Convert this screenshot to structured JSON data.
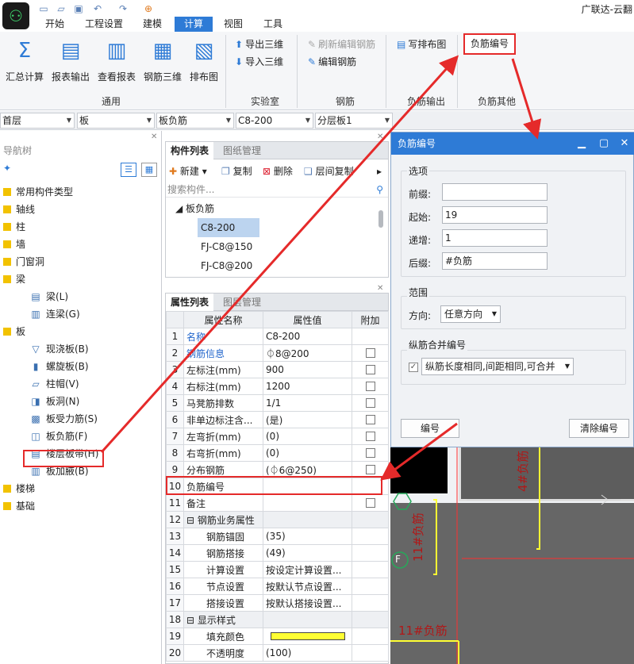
{
  "window": {
    "title": "广联达-云翻"
  },
  "menus": [
    "开始",
    "工程设置",
    "建模",
    "计算",
    "视图",
    "工具"
  ],
  "ribbon": {
    "big_buttons": [
      "汇总计算",
      "报表输出",
      "查看报表",
      "钢筋三维",
      "排布图"
    ],
    "lab_buttons": [
      "导出三维",
      "导入三维"
    ],
    "rebar_buttons": [
      "刷新编辑钢筋",
      "编辑钢筋"
    ],
    "output_button": "写排布图",
    "other_button": "负筋编号",
    "groups": [
      "通用",
      "实验室",
      "钢筋",
      "负筋输出",
      "负筋其他"
    ]
  },
  "selectors": [
    "首层",
    "板",
    "板负筋",
    "C8-200",
    "分层板1"
  ],
  "nav": {
    "title": "导航树",
    "items": [
      {
        "label": "常用构件类型",
        "level": 0
      },
      {
        "label": "轴线",
        "level": 0
      },
      {
        "label": "柱",
        "level": 0
      },
      {
        "label": "墙",
        "level": 0
      },
      {
        "label": "门窗洞",
        "level": 0
      },
      {
        "label": "梁",
        "level": 0
      },
      {
        "label": "梁(L)",
        "level": 1
      },
      {
        "label": "连梁(G)",
        "level": 1
      },
      {
        "label": "板",
        "level": 0
      },
      {
        "label": "现浇板(B)",
        "level": 1
      },
      {
        "label": "螺旋板(B)",
        "level": 1
      },
      {
        "label": "柱帽(V)",
        "level": 1
      },
      {
        "label": "板洞(N)",
        "level": 1
      },
      {
        "label": "板受力筋(S)",
        "level": 1
      },
      {
        "label": "板负筋(F)",
        "level": 1
      },
      {
        "label": "楼层板带(H)",
        "level": 1
      },
      {
        "label": "板加腋(B)",
        "level": 1
      },
      {
        "label": "楼梯",
        "level": 0
      },
      {
        "label": "基础",
        "level": 0
      }
    ]
  },
  "component_list": {
    "tabs": [
      "构件列表",
      "图纸管理"
    ],
    "toolbar": [
      "新建",
      "复制",
      "删除",
      "层间复制"
    ],
    "search_placeholder": "搜索构件...",
    "group": "板负筋",
    "items": [
      "C8-200",
      "FJ-C8@150",
      "FJ-C8@200"
    ]
  },
  "properties": {
    "tabs": [
      "属性列表",
      "图层管理"
    ],
    "headers": [
      "属性名称",
      "属性值",
      "附加"
    ],
    "rows": [
      {
        "n": "1",
        "name": "名称",
        "value": "C8-200",
        "chk": false,
        "blue": true
      },
      {
        "n": "2",
        "name": "钢筋信息",
        "value": "⏀8@200",
        "chk": true,
        "blue": true
      },
      {
        "n": "3",
        "name": "左标注(mm)",
        "value": "900",
        "chk": true
      },
      {
        "n": "4",
        "name": "右标注(mm)",
        "value": "1200",
        "chk": true
      },
      {
        "n": "5",
        "name": "马凳筋排数",
        "value": "1/1",
        "chk": true
      },
      {
        "n": "6",
        "name": "非单边标注含...",
        "value": "(是)",
        "chk": true
      },
      {
        "n": "7",
        "name": "左弯折(mm)",
        "value": "(0)",
        "chk": true
      },
      {
        "n": "8",
        "name": "右弯折(mm)",
        "value": "(0)",
        "chk": true
      },
      {
        "n": "9",
        "name": "分布钢筋",
        "value": "(⏀6@250)",
        "chk": true
      },
      {
        "n": "10",
        "name": "负筋编号",
        "value": "",
        "chk": false
      },
      {
        "n": "11",
        "name": "备注",
        "value": "",
        "chk": true
      },
      {
        "n": "12",
        "name": "钢筋业务属性",
        "value": "",
        "chk": false,
        "group": true
      },
      {
        "n": "13",
        "name": "钢筋锚固",
        "value": "(35)",
        "chk": false,
        "sub": true
      },
      {
        "n": "14",
        "name": "钢筋搭接",
        "value": "(49)",
        "chk": false,
        "sub": true
      },
      {
        "n": "15",
        "name": "计算设置",
        "value": "按设定计算设置...",
        "chk": false,
        "sub": true
      },
      {
        "n": "16",
        "name": "节点设置",
        "value": "按默认节点设置...",
        "chk": false,
        "sub": true
      },
      {
        "n": "17",
        "name": "搭接设置",
        "value": "按默认搭接设置...",
        "chk": false,
        "sub": true
      },
      {
        "n": "18",
        "name": "显示样式",
        "value": "",
        "chk": false,
        "group": true
      },
      {
        "n": "19",
        "name": "填充颜色",
        "value": "",
        "chk": false,
        "sub": true,
        "swatch": "#ffff33"
      },
      {
        "n": "20",
        "name": "不透明度",
        "value": "(100)",
        "chk": false,
        "sub": true
      }
    ]
  },
  "dialog": {
    "title": "负筋编号",
    "options_legend": "选项",
    "prefix_label": "前缀:",
    "prefix_value": "",
    "start_label": "起始:",
    "start_value": "19",
    "step_label": "递增:",
    "step_value": "1",
    "suffix_label": "后缀:",
    "suffix_value": "#负筋",
    "range_legend": "范围",
    "direction_label": "方向:",
    "direction_value": "任意方向",
    "merge_legend": "纵筋合并编号",
    "merge_value": "纵筋长度相同,间距相同,可合并",
    "number_button": "编号",
    "clear_button": "清除编号"
  },
  "canvas": {
    "label_right": "4#负筋",
    "label_left": "11#负筋",
    "label_bottom": "11#负筋",
    "marker": "F"
  },
  "colors": {
    "accent": "#2e7bd6",
    "highlight": "#e52a2a",
    "rebar": "#ffff33"
  }
}
